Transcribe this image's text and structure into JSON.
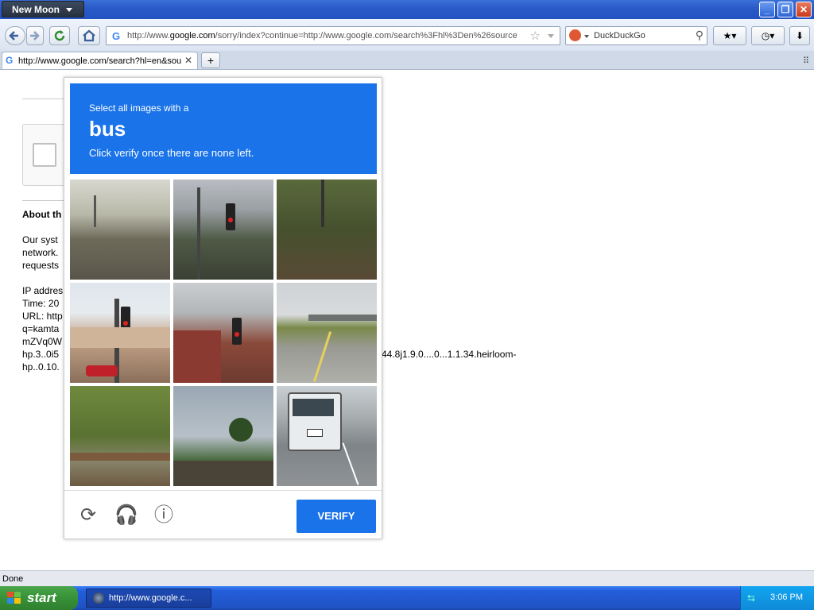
{
  "window": {
    "app_menu_label": "New Moon",
    "minimize": "_",
    "maximize": "❐",
    "close": "✕"
  },
  "nav": {
    "url_prefix": "http://www.",
    "url_domain": "google.com",
    "url_rest": "/sorry/index?continue=http://www.google.com/search%3Fhl%3Den%26source",
    "search_engine": "DuckDuckGo"
  },
  "tab": {
    "title": "http://www.google.com/search?hl=en&sou",
    "new_tab": "+"
  },
  "page": {
    "about_heading": "About th",
    "para1": "Our syst\nnetwork.\nrequests",
    "para2": "IP addres\nTime: 20\nURL: http\nq=kamta\nmZVq0W\nhp.3..0i5\nhp..0.10.",
    "tail_text": "44.8j1.9.0....0...1.1.34.heirloom-"
  },
  "captcha": {
    "line1": "Select all images with a",
    "target": "bus",
    "line3": "Click verify once there are none left.",
    "tiles": [
      "street",
      "traffic-signal",
      "trees",
      "house-signal",
      "brick-building-signal",
      "highway",
      "bush-fence",
      "palm-tree",
      "bus"
    ],
    "verify_label": "VERIFY",
    "icons": [
      "reload-icon",
      "headphones-icon",
      "info-icon"
    ]
  },
  "status": {
    "text": "Done"
  },
  "taskbar": {
    "start_label": "start",
    "task_label": "http://www.google.c...",
    "clock": "3:06 PM"
  },
  "colors": {
    "accent": "#1a73e8",
    "taskbar": "#245edb",
    "start": "#3a963a"
  }
}
